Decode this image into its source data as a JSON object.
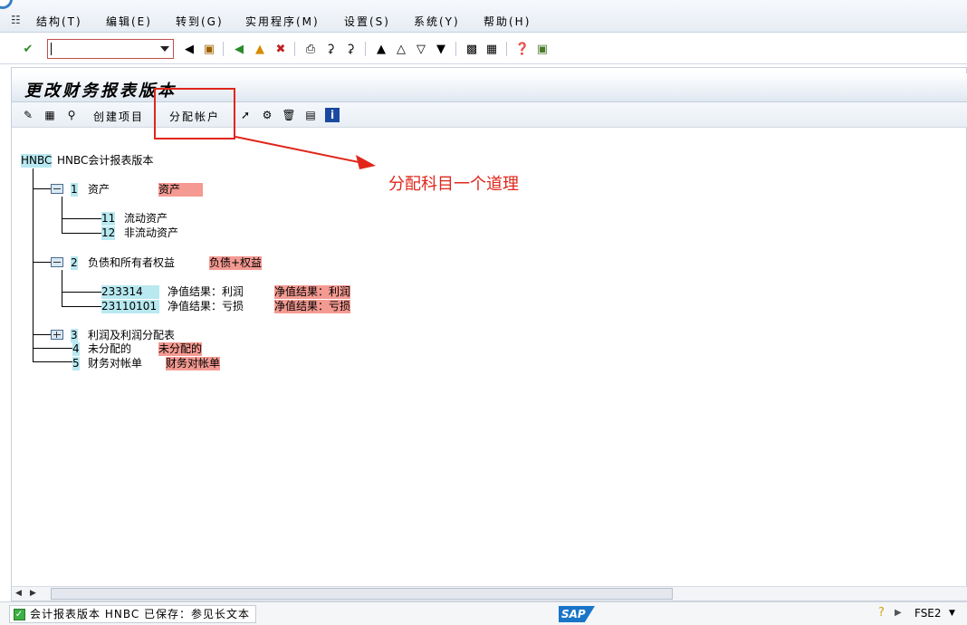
{
  "menu": {
    "items": [
      "结构(T)",
      "编辑(E)",
      "转到(G)",
      "实用程序(M)",
      "设置(S)",
      "系统(Y)",
      "帮助(H)"
    ]
  },
  "command_field": {
    "value": ""
  },
  "screen": {
    "title": "更改财务报表版本"
  },
  "app_toolbar": {
    "create_item": "创建项目",
    "assign_accounts": "分配帐户"
  },
  "tree": {
    "root": {
      "code": "HNBC",
      "text": "HNBC会计报表版本"
    },
    "nodes": [
      {
        "num": "1",
        "text": "资产",
        "tag": "资产"
      },
      {
        "num": "11",
        "text": "流动资产"
      },
      {
        "num": "12",
        "text": "非流动资产"
      },
      {
        "num": "2",
        "text": "负债和所有者权益",
        "tag": "负债+权益"
      },
      {
        "num": "233314",
        "text": "净值结果：利润",
        "tag": "净值结果：利润"
      },
      {
        "num": "23110101",
        "text": "净值结果：亏损",
        "tag": "净值结果：亏损"
      },
      {
        "num": "3",
        "text": "利润及利润分配表"
      },
      {
        "num": "4",
        "text": "未分配的",
        "tag": "未分配的"
      },
      {
        "num": "5",
        "text": "财务对帐单",
        "tag": "财务对帐单"
      }
    ]
  },
  "annotation": {
    "text": "分配科目一个道理"
  },
  "status": {
    "message": "会计报表版本 HNBC 已保存：参见长文本",
    "system": "FSE2"
  },
  "logo": {
    "text": "SAP"
  },
  "colors": {
    "highlight_red": "#e0261b",
    "tag_pink": "#f49a92",
    "num_cyan": "#b8e8f0"
  }
}
